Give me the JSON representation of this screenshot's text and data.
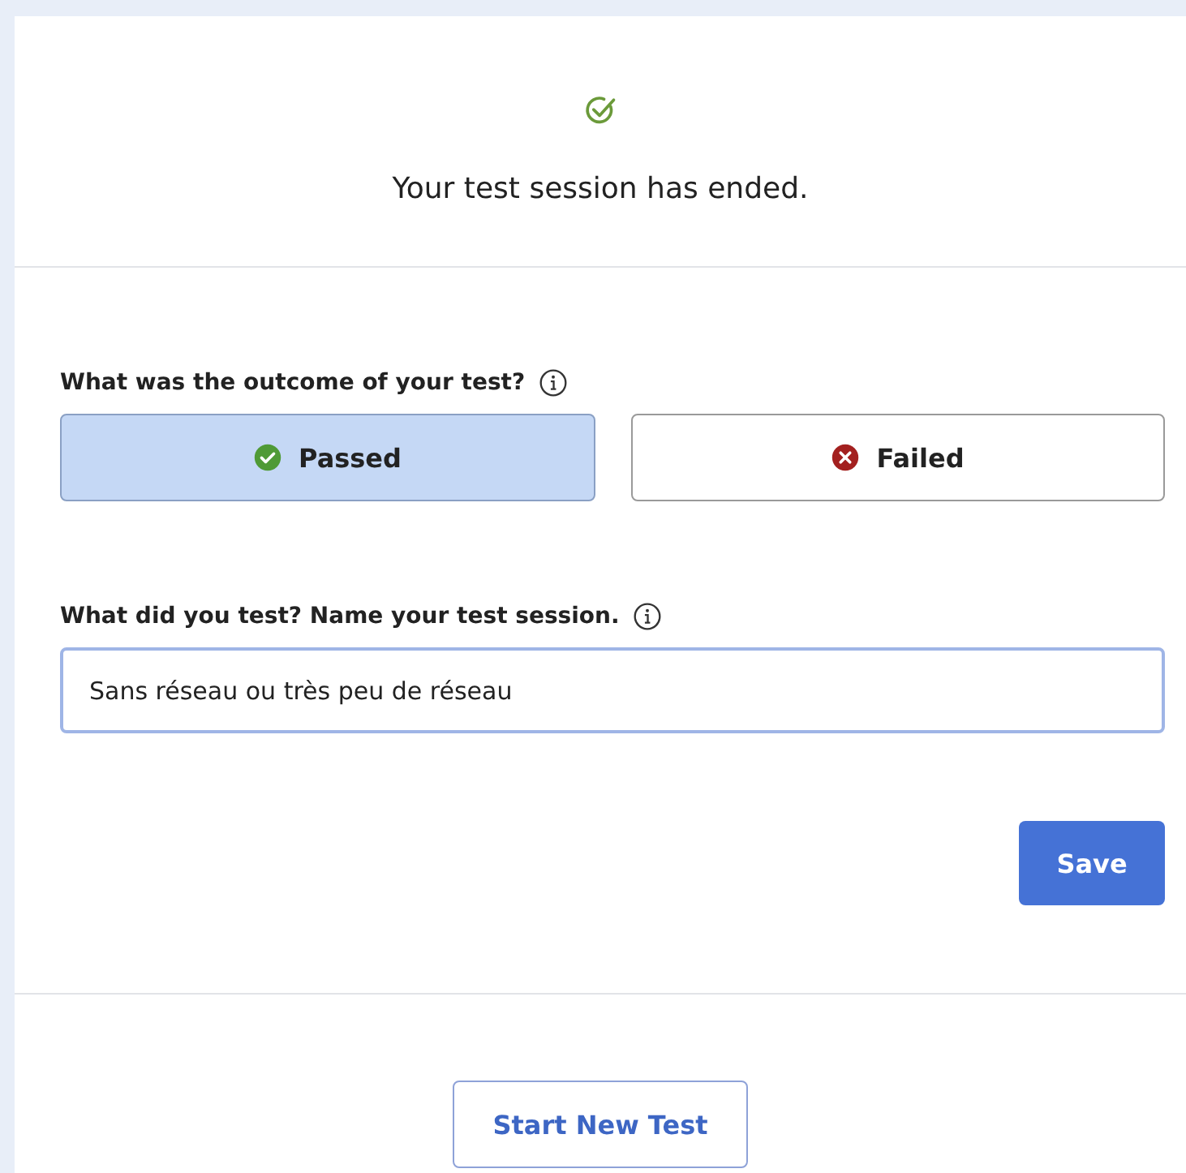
{
  "header": {
    "title": "Your test session has ended."
  },
  "outcome": {
    "label": "What was the outcome of your test?",
    "options": [
      {
        "kind": "passed",
        "label": "Passed",
        "selected": true
      },
      {
        "kind": "failed",
        "label": "Failed",
        "selected": false
      }
    ]
  },
  "session_name": {
    "label": "What did you test? Name your test session.",
    "value": "Sans réseau ou très peu de réseau"
  },
  "save_button": "Save",
  "start_button": "Start New Test"
}
